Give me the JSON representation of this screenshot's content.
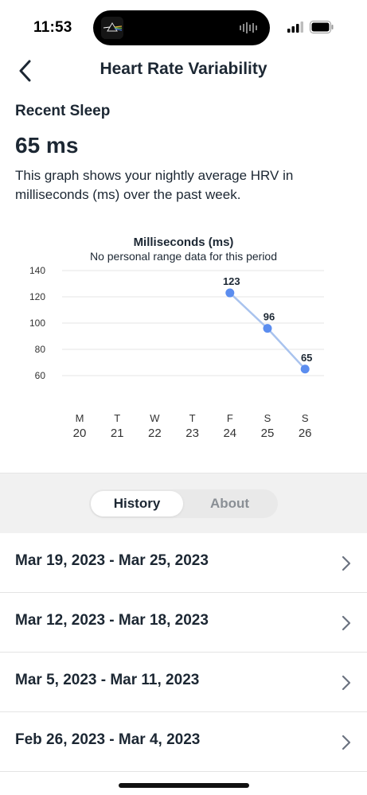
{
  "status_bar": {
    "time": "11:53"
  },
  "header": {
    "title": "Heart Rate Variability"
  },
  "summary": {
    "section_label": "Recent Sleep",
    "value": "65 ms",
    "description": "This graph shows your nightly average HRV in milliseconds (ms) over the past week."
  },
  "chart_data": {
    "type": "line",
    "title": "Milliseconds (ms)",
    "subtitle": "No personal range data for this period",
    "ylim": [
      60,
      140
    ],
    "yticks": [
      140,
      120,
      100,
      80,
      60
    ],
    "grid": true,
    "days": [
      {
        "letter": "M",
        "date": "20"
      },
      {
        "letter": "T",
        "date": "21"
      },
      {
        "letter": "W",
        "date": "22"
      },
      {
        "letter": "T",
        "date": "23"
      },
      {
        "letter": "F",
        "date": "24"
      },
      {
        "letter": "S",
        "date": "25"
      },
      {
        "letter": "S",
        "date": "26"
      }
    ],
    "series": [
      {
        "values": [
          null,
          null,
          null,
          null,
          123,
          96,
          65
        ]
      }
    ],
    "colors": {
      "line": "#a9c3ee",
      "point": "#5b8def",
      "grid": "#e6e6e6",
      "axis_text": "#333333"
    }
  },
  "segmented_control": {
    "tabs": [
      {
        "label": "History",
        "active": true
      },
      {
        "label": "About",
        "active": false
      }
    ]
  },
  "history": {
    "items": [
      {
        "label": "Mar 19, 2023 - Mar 25, 2023"
      },
      {
        "label": "Mar 12, 2023 - Mar 18, 2023"
      },
      {
        "label": "Mar 5, 2023 - Mar 11, 2023"
      },
      {
        "label": "Feb 26, 2023 - Mar 4, 2023"
      }
    ]
  }
}
